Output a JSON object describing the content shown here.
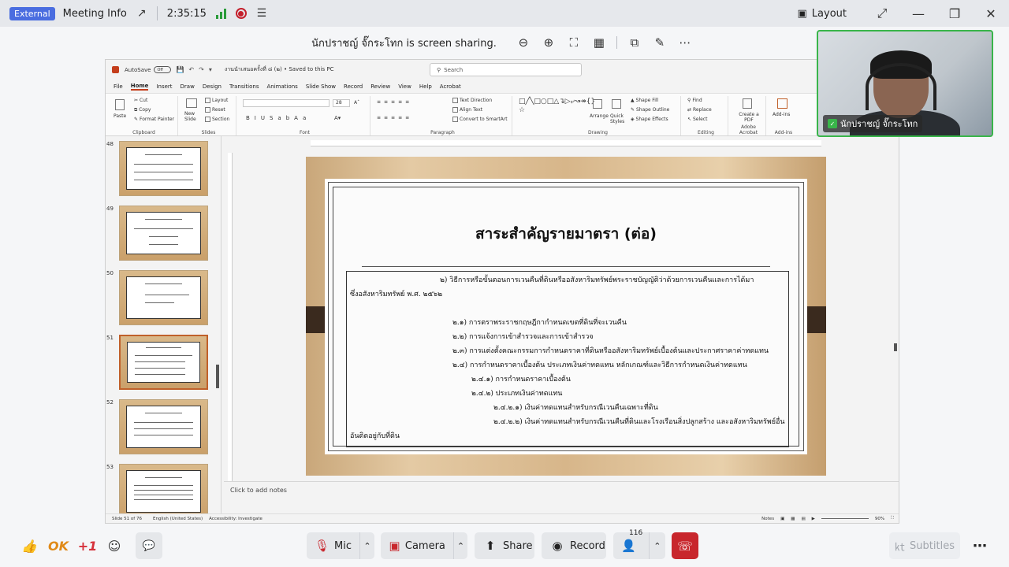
{
  "topbar": {
    "badge": "External",
    "meeting_info": "Meeting Info",
    "timer": "2:35:15",
    "layout_label": "Layout"
  },
  "sharebar": {
    "text": "นักปราชญ์ จั๊กระโทก is screen sharing."
  },
  "ppt": {
    "autosave": "AutoSave",
    "toggle": "Off",
    "docname": "งานนำเสนอครั้งที่ ๘ (๒) • Saved to this PC",
    "search_placeholder": "Search",
    "menu": [
      "File",
      "Home",
      "Insert",
      "Draw",
      "Design",
      "Transitions",
      "Animations",
      "Slide Show",
      "Record",
      "Review",
      "View",
      "Help",
      "Acrobat"
    ],
    "ribbon": {
      "clipboard": "Clipboard",
      "paste": "Paste",
      "cut": "Cut",
      "copy": "Copy",
      "format_painter": "Format Painter",
      "slides": "Slides",
      "new_slide": "New Slide",
      "layout": "Layout",
      "reset": "Reset",
      "section": "Section",
      "font": "Font",
      "font_size": "28",
      "paragraph": "Paragraph",
      "text_direction": "Text Direction",
      "align_text": "Align Text",
      "convert_smartart": "Convert to SmartArt",
      "drawing": "Drawing",
      "arrange": "Arrange",
      "quick_styles": "Quick Styles",
      "shape_fill": "Shape Fill",
      "shape_outline": "Shape Outline",
      "shape_effects": "Shape Effects",
      "editing": "Editing",
      "find": "Find",
      "replace": "Replace",
      "select": "Select",
      "create_pdf": "Create a PDF",
      "adobe_acrobat": "Adobe Acrobat",
      "addins": "Add-ins",
      "addins_group": "Add-ins"
    },
    "thumbnails": [
      "48",
      "49",
      "50",
      "51",
      "52",
      "53"
    ],
    "slide": {
      "title": "สาระสำคัญรายมาตรา (ต่อ)",
      "lines": [
        "๒) วิธีการหรือขั้นตอนการเวนคืนที่ดินหรืออสังหาริมทรัพย์พระราชบัญญัติว่าด้วยการเวนคืนและการได้มา",
        "ซึ่งอสังหาริมทรัพย์ พ.ศ. ๒๕๖๒",
        "๒.๑) การตราพระราชกฤษฎีกากำหนดเขตที่ดินที่จะเวนคืน",
        "๒.๒) การแจ้งการเข้าสำรวจและการเข้าสำรวจ",
        "๒.๓) การแต่งตั้งคณะกรรมการกำหนดราคาที่ดินหรืออสังหาริมทรัพย์เบื้องต้นและประกาศราคาค่าทดแทน",
        "๒.๔) การกำหนดราคาเบื้องต้น ประเภทเงินค่าทดแทน หลักเกณฑ์และวิธีการกำหนดเงินค่าทดแทน",
        "๒.๔.๑) การกำหนดราคาเบื้องต้น",
        "๒.๔.๒) ประเภทเงินค่าทดแทน",
        "๒.๔.๒.๑) เงินค่าทดแทนสำหรับกรณีเวนคืนเฉพาะที่ดิน",
        "๒.๔.๒.๒) เงินค่าทดแทนสำหรับกรณีเวนคืนที่ดินและโรงเรือนสิ่งปลูกสร้าง และอสังหาริมทรัพย์อื่น",
        "อันติดอยู่กับที่ดิน"
      ]
    },
    "notes": "Click to add notes",
    "status": {
      "slide": "Slide 51 of 76",
      "language": "English (United States)",
      "accessibility": "Accessibility: Investigate",
      "notes": "Notes",
      "zoom": "90%"
    }
  },
  "video": {
    "name": "นักปราชญ์ จั๊กระโทก"
  },
  "controls": {
    "ok": "OK",
    "plus_one": "+1",
    "mic": "Mic",
    "camera": "Camera",
    "share": "Share",
    "record": "Record",
    "people_count": "116",
    "subtitles": "Subtitles"
  }
}
